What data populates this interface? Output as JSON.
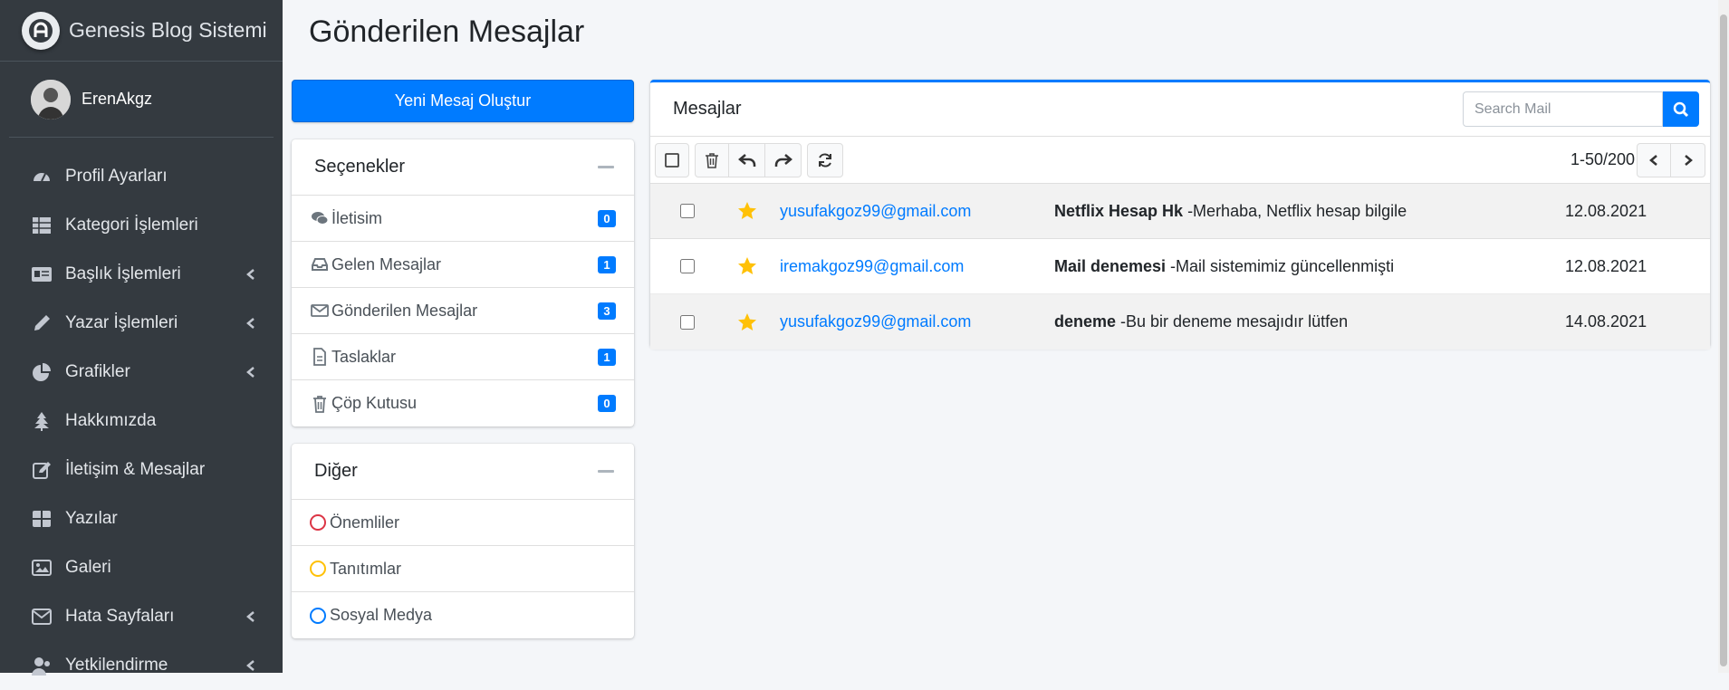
{
  "brand": {
    "name": "Genesis Blog Sistemi"
  },
  "user": {
    "name": "ErenAkgz"
  },
  "sidebar": {
    "items": [
      {
        "label": "Profil Ayarları",
        "icon": "tachometer-icon",
        "has_submenu": false
      },
      {
        "label": "Kategori İşlemleri",
        "icon": "table-icon",
        "has_submenu": false
      },
      {
        "label": "Başlık İşlemleri",
        "icon": "id-card-icon",
        "has_submenu": true
      },
      {
        "label": "Yazar İşlemleri",
        "icon": "pencil-icon",
        "has_submenu": true
      },
      {
        "label": "Grafikler",
        "icon": "pie-chart-icon",
        "has_submenu": true
      },
      {
        "label": "Hakkımızda",
        "icon": "tree-icon",
        "has_submenu": false
      },
      {
        "label": "İletişim & Mesajlar",
        "icon": "edit-icon",
        "has_submenu": false
      },
      {
        "label": "Yazılar",
        "icon": "th-large-icon",
        "has_submenu": false
      },
      {
        "label": "Galeri",
        "icon": "image-icon",
        "has_submenu": false
      },
      {
        "label": "Hata Sayfaları",
        "icon": "envelope-icon",
        "has_submenu": true
      },
      {
        "label": "Yetkilendirme",
        "icon": "users-icon",
        "has_submenu": true
      }
    ]
  },
  "page": {
    "title": "Gönderilen Mesajlar"
  },
  "compose": {
    "label": "Yeni Mesaj Oluştur"
  },
  "folders": {
    "title": "Seçenekler",
    "items": [
      {
        "label": "İletisim",
        "count": "0",
        "icon": "comments-icon"
      },
      {
        "label": "Gelen Mesajlar",
        "count": "1",
        "icon": "inbox-icon"
      },
      {
        "label": "Gönderilen Mesajlar",
        "count": "3",
        "icon": "envelope-icon"
      },
      {
        "label": "Taslaklar",
        "count": "1",
        "icon": "file-icon"
      },
      {
        "label": "Çöp Kutusu",
        "count": "0",
        "icon": "trash-icon"
      }
    ]
  },
  "labels": {
    "title": "Diğer",
    "items": [
      {
        "label": "Önemliler",
        "color": "#dc3545"
      },
      {
        "label": "Tanıtımlar",
        "color": "#ffc107"
      },
      {
        "label": "Sosyal Medya",
        "color": "#007bff"
      }
    ]
  },
  "mailbox": {
    "title": "Mesajlar",
    "search_placeholder": "Search Mail",
    "pager": "1-50/200",
    "messages": [
      {
        "sender": "yusufakgoz99@gmail.com",
        "subject": "Netflix Hesap Hk",
        "preview": " -Merhaba, Netflix hesap bilgile",
        "date": "12.08.2021",
        "starred": true
      },
      {
        "sender": "iremakgoz99@gmail.com",
        "subject": "Mail denemesi",
        "preview": " -Mail sistemimiz güncellenmişti",
        "date": "12.08.2021",
        "starred": true
      },
      {
        "sender": "yusufakgoz99@gmail.com",
        "subject": "deneme",
        "preview": " -Bu bir deneme mesajıdır lütfen",
        "date": "14.08.2021",
        "starred": true
      }
    ]
  },
  "colors": {
    "sidebar_bg": "#343a40",
    "primary": "#007bff",
    "star": "#ffc107"
  }
}
